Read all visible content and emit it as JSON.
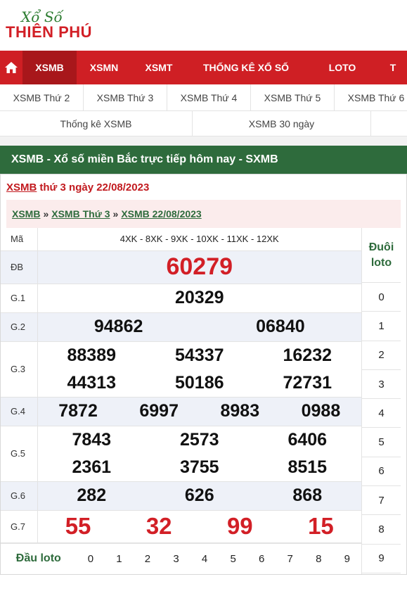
{
  "brand": {
    "top": "Xổ Số",
    "main": "THIÊN PHÚ"
  },
  "nav": [
    "XSMB",
    "XSMN",
    "XSMT",
    "THỐNG KÊ XỔ SỐ",
    "LOTO",
    "T"
  ],
  "subnav": [
    "XSMB Thứ 2",
    "XSMB Thứ 3",
    "XSMB Thứ 4",
    "XSMB Thứ 5",
    "XSMB Thứ 6"
  ],
  "subnav2": [
    "Thống kê XSMB",
    "XSMB 30 ngày"
  ],
  "section_title": "XSMB - Xổ số miền Bắc trực tiếp hôm nay - SXMB",
  "result_title": {
    "link": "XSMB",
    "rest": "thứ 3 ngày 22/08/2023"
  },
  "breadcrumb": [
    "XSMB",
    "XSMB Thứ 3",
    "XSMB 22/08/2023"
  ],
  "breadcrumb_sep": "»",
  "results": {
    "ma_label": "Mã",
    "ma_value": "4XK - 8XK - 9XK - 10XK - 11XK - 12XK",
    "db_label": "ĐB",
    "db": "60279",
    "g1_label": "G.1",
    "g1": [
      "20329"
    ],
    "g2_label": "G.2",
    "g2": [
      "94862",
      "06840"
    ],
    "g3_label": "G.3",
    "g3": [
      "88389",
      "54337",
      "16232",
      "44313",
      "50186",
      "72731"
    ],
    "g4_label": "G.4",
    "g4": [
      "7872",
      "6997",
      "8983",
      "0988"
    ],
    "g5_label": "G.5",
    "g5": [
      "7843",
      "2573",
      "6406",
      "2361",
      "3755",
      "8515"
    ],
    "g6_label": "G.6",
    "g6": [
      "282",
      "626",
      "868"
    ],
    "g7_label": "G.7",
    "g7": [
      "55",
      "32",
      "99",
      "15"
    ]
  },
  "dau_loto": {
    "label": "Đầu loto",
    "digits": [
      "0",
      "1",
      "2",
      "3",
      "4",
      "5",
      "6",
      "7",
      "8",
      "9"
    ]
  },
  "duoi_loto": {
    "label_1": "Đuôi",
    "label_2": "loto",
    "digits": [
      "0",
      "1",
      "2",
      "3",
      "4",
      "5",
      "6",
      "7",
      "8",
      "9"
    ]
  }
}
